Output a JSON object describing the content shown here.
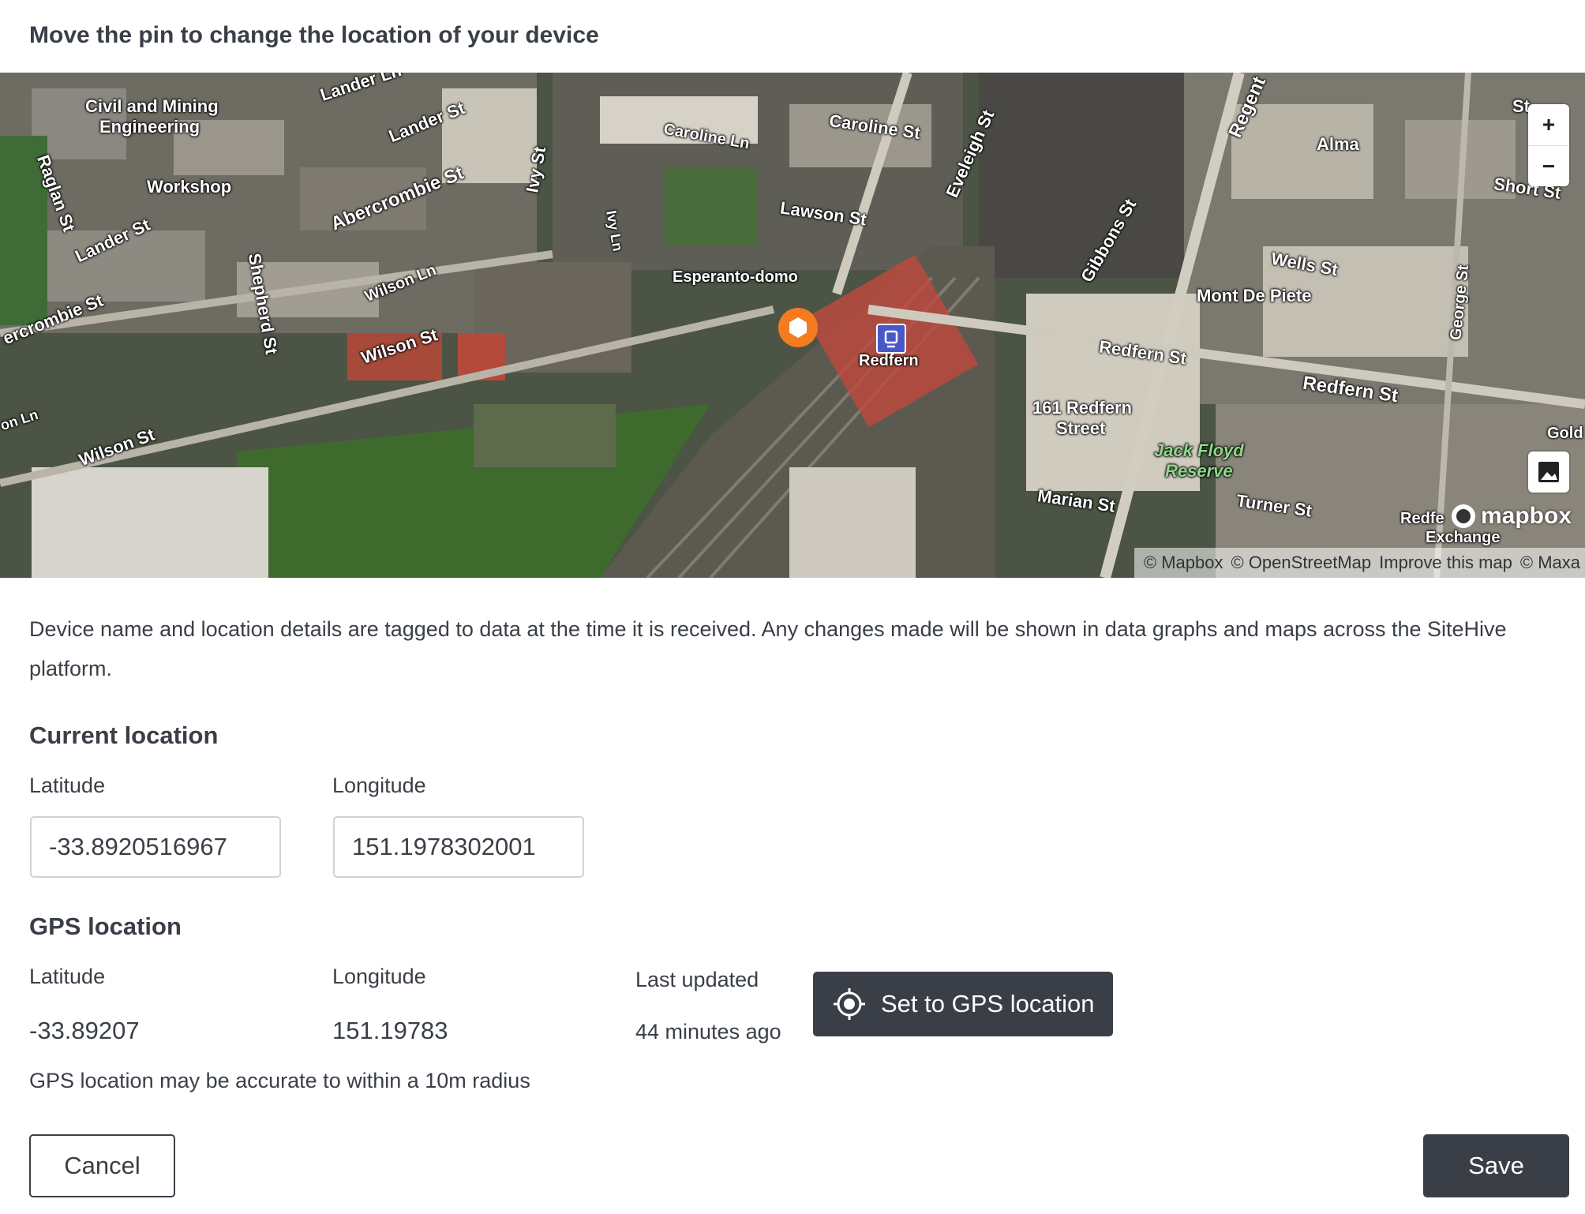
{
  "header": {
    "title": "Move the pin to change the location of your device"
  },
  "map": {
    "labels": [
      {
        "text": "Civil and Mining",
        "kind": "poi"
      },
      {
        "text": "Engineering",
        "kind": "poi"
      },
      {
        "text": "Workshop",
        "kind": "poi"
      },
      {
        "text": "Lander Ln",
        "kind": "street"
      },
      {
        "text": "Lander St",
        "kind": "street"
      },
      {
        "text": "Lander St",
        "kind": "street"
      },
      {
        "text": "Raglan St",
        "kind": "street"
      },
      {
        "text": "Abercrombie St",
        "kind": "street"
      },
      {
        "text": "ercrombie St",
        "kind": "street"
      },
      {
        "text": "Shepherd St",
        "kind": "street"
      },
      {
        "text": "Wilson Ln",
        "kind": "street"
      },
      {
        "text": "Wilson St",
        "kind": "street"
      },
      {
        "text": "Wilson St",
        "kind": "street"
      },
      {
        "text": "on Ln",
        "kind": "street"
      },
      {
        "text": "Ivy St",
        "kind": "street"
      },
      {
        "text": "Ivy Ln",
        "kind": "street"
      },
      {
        "text": "Caroline Ln",
        "kind": "street"
      },
      {
        "text": "Caroline St",
        "kind": "street"
      },
      {
        "text": "Lawson St",
        "kind": "street"
      },
      {
        "text": "Eveleigh St",
        "kind": "street"
      },
      {
        "text": "Esperanto-domo",
        "kind": "poi"
      },
      {
        "text": "Redfern",
        "kind": "poi"
      },
      {
        "text": "Regent",
        "kind": "street"
      },
      {
        "text": "Gibbons St",
        "kind": "street"
      },
      {
        "text": "Alma",
        "kind": "street"
      },
      {
        "text": "Wells St",
        "kind": "street"
      },
      {
        "text": "Mont De Piete",
        "kind": "poi"
      },
      {
        "text": "Short St",
        "kind": "street"
      },
      {
        "text": "St",
        "kind": "street"
      },
      {
        "text": "George St",
        "kind": "street"
      },
      {
        "text": "Redfern St",
        "kind": "street"
      },
      {
        "text": "Redfern St",
        "kind": "street"
      },
      {
        "text": "161 Redfern",
        "kind": "poi"
      },
      {
        "text": "Street",
        "kind": "poi"
      },
      {
        "text": "Jack Floyd",
        "kind": "park"
      },
      {
        "text": "Reserve",
        "kind": "park"
      },
      {
        "text": "Marian St",
        "kind": "street"
      },
      {
        "text": "Turner St",
        "kind": "street"
      },
      {
        "text": "Gold",
        "kind": "street"
      },
      {
        "text": "Redfe",
        "kind": "poi"
      },
      {
        "text": "Exchange",
        "kind": "poi"
      }
    ],
    "zoom_in_label": "+",
    "zoom_out_label": "−",
    "logo_text": "mapbox",
    "attribution": {
      "mapbox": "© Mapbox",
      "osm": "© OpenStreetMap",
      "improve": "Improve this map",
      "maxar": "© Maxa"
    }
  },
  "description": "Device name and location details are tagged to data at the time it is received. Any changes made will be shown in data graphs and maps across the SiteHive platform.",
  "current_location": {
    "title": "Current location",
    "latitude_label": "Latitude",
    "longitude_label": "Longitude",
    "latitude_value": "-33.8920516967",
    "longitude_value": "151.1978302001"
  },
  "gps_location": {
    "title": "GPS location",
    "latitude_label": "Latitude",
    "longitude_label": "Longitude",
    "last_updated_label": "Last updated",
    "latitude_value": "-33.89207",
    "longitude_value": "151.19783",
    "last_updated_value": "44 minutes ago",
    "button_label": "Set to GPS location",
    "accuracy_note": "GPS location may be accurate to within a 10m radius"
  },
  "footer": {
    "cancel_label": "Cancel",
    "save_label": "Save"
  },
  "colors": {
    "primary_dark": "#3a3f47",
    "pin_orange": "#f47b20",
    "station_blue": "#4a57c7",
    "input_border": "#cfd3d8"
  }
}
